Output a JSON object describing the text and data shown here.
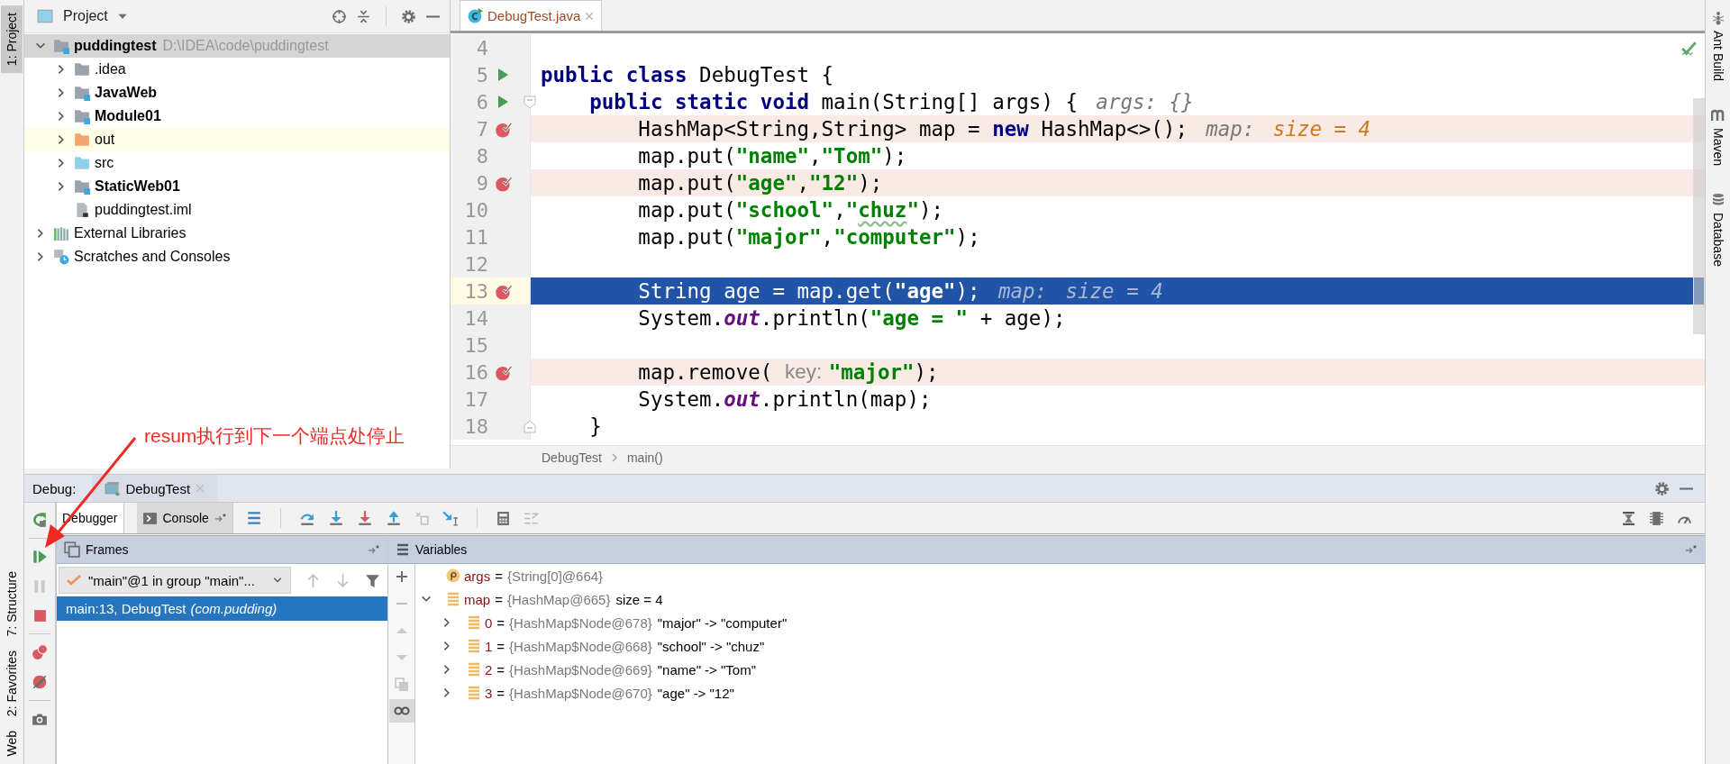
{
  "left_stripe": [
    {
      "label": "1: Project",
      "selected": true
    },
    {
      "label": "7: Structure",
      "selected": false
    },
    {
      "label": "2: Favorites",
      "selected": false
    },
    {
      "label": "Web",
      "selected": false
    }
  ],
  "project": {
    "title": "Project",
    "tree": [
      {
        "kind": "module",
        "name": "puddingtest",
        "path": "D:\\IDEA\\code\\puddingtest",
        "expanded": true,
        "selected": true,
        "children": [
          {
            "kind": "folder",
            "name": ".idea",
            "expanded": false,
            "selected": false
          },
          {
            "kind": "module",
            "name": "JavaWeb",
            "expanded": false,
            "selected": false
          },
          {
            "kind": "module",
            "name": "Module01",
            "expanded": false,
            "selected": false
          },
          {
            "kind": "excluded",
            "name": "out",
            "expanded": false,
            "selected": false
          },
          {
            "kind": "source",
            "name": "src",
            "expanded": false,
            "selected": false
          },
          {
            "kind": "module",
            "name": "StaticWeb01",
            "expanded": false,
            "selected": false
          },
          {
            "kind": "file",
            "name": "puddingtest.iml",
            "selected": false
          }
        ]
      },
      {
        "kind": "libraries",
        "name": "External Libraries",
        "expanded": false,
        "selected": false
      },
      {
        "kind": "scratches",
        "name": "Scratches and Consoles",
        "expanded": false,
        "selected": false
      }
    ]
  },
  "editor": {
    "tab": {
      "label": "DebugTest.java",
      "selected": true
    },
    "lines": [
      {
        "number": "4",
        "run_marker": false,
        "breakpoint": false,
        "current": false
      },
      {
        "number": "5",
        "run_marker": true,
        "breakpoint": false,
        "current": false,
        "tokens": [
          {
            "kind": "keyword",
            "text": "public class"
          },
          {
            "kind": "plain",
            "text": " DebugTest {"
          }
        ]
      },
      {
        "number": "6",
        "run_marker": true,
        "breakpoint": false,
        "current": false,
        "fold_start": true,
        "tokens": [
          {
            "kind": "keyword",
            "text": "    public static void"
          },
          {
            "kind": "plain",
            "text": " main(String[] args) {"
          },
          {
            "kind": "hint",
            "text": "args: {}"
          }
        ]
      },
      {
        "number": "7",
        "run_marker": false,
        "breakpoint": true,
        "current": false,
        "tokens": [
          {
            "kind": "plain",
            "text": "        HashMap<String,String> map = "
          },
          {
            "kind": "keyword",
            "text": "new"
          },
          {
            "kind": "plain",
            "text": " HashMap<>();"
          },
          {
            "kind": "hint",
            "text": "map:"
          },
          {
            "kind": "value",
            "text": "size = 4"
          }
        ]
      },
      {
        "number": "8",
        "run_marker": false,
        "breakpoint": false,
        "current": false,
        "tokens": [
          {
            "kind": "plain",
            "text": "        map.put("
          },
          {
            "kind": "string",
            "text": "\"name\""
          },
          {
            "kind": "plain",
            "text": ","
          },
          {
            "kind": "string",
            "text": "\"Tom\""
          },
          {
            "kind": "plain",
            "text": ");"
          }
        ]
      },
      {
        "number": "9",
        "run_marker": false,
        "breakpoint": true,
        "current": false,
        "tokens": [
          {
            "kind": "plain",
            "text": "        map.put("
          },
          {
            "kind": "string",
            "text": "\"age\""
          },
          {
            "kind": "plain",
            "text": ","
          },
          {
            "kind": "string",
            "text": "\"12\""
          },
          {
            "kind": "plain",
            "text": ");"
          }
        ]
      },
      {
        "number": "10",
        "run_marker": false,
        "breakpoint": false,
        "current": false,
        "tokens": [
          {
            "kind": "plain",
            "text": "        map.put("
          },
          {
            "kind": "string",
            "text": "\"school\""
          },
          {
            "kind": "plain",
            "text": ","
          },
          {
            "kind": "string",
            "text": "\""
          },
          {
            "kind": "typo",
            "text": "chuz"
          },
          {
            "kind": "string",
            "text": "\""
          },
          {
            "kind": "plain",
            "text": ");"
          }
        ]
      },
      {
        "number": "11",
        "run_marker": false,
        "breakpoint": false,
        "current": false,
        "tokens": [
          {
            "kind": "plain",
            "text": "        map.put("
          },
          {
            "kind": "string",
            "text": "\"major\""
          },
          {
            "kind": "plain",
            "text": ","
          },
          {
            "kind": "string",
            "text": "\"computer\""
          },
          {
            "kind": "plain",
            "text": ");"
          }
        ]
      },
      {
        "number": "12",
        "run_marker": false,
        "breakpoint": false,
        "current": false
      },
      {
        "number": "13",
        "run_marker": false,
        "breakpoint": true,
        "current": true,
        "tokens": [
          {
            "kind": "plain",
            "text": "        String age = map.get("
          },
          {
            "kind": "string",
            "text": "\"age\""
          },
          {
            "kind": "plain",
            "text": ");"
          },
          {
            "kind": "hint",
            "text": "map:"
          },
          {
            "kind": "value",
            "text": "size = 4"
          }
        ]
      },
      {
        "number": "14",
        "run_marker": false,
        "breakpoint": false,
        "current": false,
        "tokens": [
          {
            "kind": "plain",
            "text": "        System."
          },
          {
            "kind": "field",
            "text": "out"
          },
          {
            "kind": "plain",
            "text": ".println("
          },
          {
            "kind": "string",
            "text": "\"age = \""
          },
          {
            "kind": "plain",
            "text": " + age);"
          }
        ]
      },
      {
        "number": "15",
        "run_marker": false,
        "breakpoint": false,
        "current": false
      },
      {
        "number": "16",
        "run_marker": false,
        "breakpoint": true,
        "current": false,
        "tokens": [
          {
            "kind": "plain",
            "text": "        map.remove( "
          },
          {
            "kind": "param",
            "text": "key:"
          },
          {
            "kind": "string",
            "text": "\"major\""
          },
          {
            "kind": "plain",
            "text": ");"
          }
        ]
      },
      {
        "number": "17",
        "run_marker": false,
        "breakpoint": false,
        "current": false,
        "tokens": [
          {
            "kind": "plain",
            "text": "        System."
          },
          {
            "kind": "field",
            "text": "out"
          },
          {
            "kind": "plain",
            "text": ".println(map);"
          }
        ]
      },
      {
        "number": "18",
        "run_marker": false,
        "breakpoint": false,
        "current": false,
        "fold_end": true,
        "tokens": [
          {
            "kind": "plain",
            "text": "    }"
          }
        ]
      }
    ],
    "breadcrumbs": [
      "DebugTest",
      "main()"
    ]
  },
  "right_stripe": [
    {
      "label": "Ant Build"
    },
    {
      "label": "Maven"
    },
    {
      "label": "Database"
    }
  ],
  "debug": {
    "label": "Debug:",
    "session_tab": {
      "label": "DebugTest"
    },
    "tabs": [
      {
        "label": "Debugger",
        "selected": true
      },
      {
        "label": "Console",
        "selected": false
      }
    ],
    "frames": {
      "title": "Frames",
      "thread": "\"main\"@1 in group \"main\"...",
      "items": [
        {
          "method": "main:13, DebugTest",
          "package": "(com.pudding)",
          "selected": true
        }
      ]
    },
    "variables": {
      "title": "Variables",
      "items": [
        {
          "kind": "param",
          "name": "args",
          "sign": "=",
          "value": "{String[0]@664}"
        },
        {
          "kind": "field",
          "name": "map",
          "sign": "=",
          "value": "{HashMap@665}",
          "extra": "size = 4",
          "expanded": true,
          "children": [
            {
              "kind": "field",
              "name": "0",
              "sign": "=",
              "value": "{HashMap$Node@678}",
              "extra": "\"major\" -> \"computer\"",
              "expanded": false
            },
            {
              "kind": "field",
              "name": "1",
              "sign": "=",
              "value": "{HashMap$Node@668}",
              "extra": "\"school\" -> \"chuz\"",
              "expanded": false
            },
            {
              "kind": "field",
              "name": "2",
              "sign": "=",
              "value": "{HashMap$Node@669}",
              "extra": "\"name\" -> \"Tom\"",
              "expanded": false
            },
            {
              "kind": "field",
              "name": "3",
              "sign": "=",
              "value": "{HashMap$Node@670}",
              "extra": "\"age\" -> \"12\"",
              "expanded": false
            }
          ]
        }
      ]
    }
  },
  "annotation": {
    "text": "resum执行到下一个端点处停止"
  }
}
